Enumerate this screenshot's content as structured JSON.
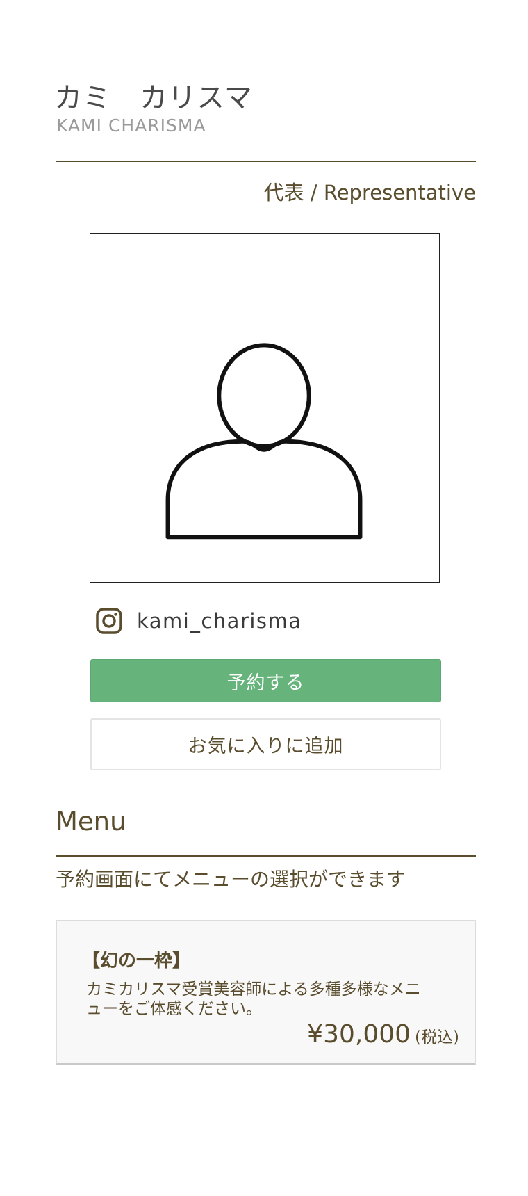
{
  "profile": {
    "name_jp": "カミ　カリスマ",
    "name_en": "KAMI CHARISMA",
    "role": "代表 / Representative",
    "photo_icon": "person-placeholder-icon",
    "instagram_icon": "instagram-icon",
    "instagram_handle": "kami_charisma"
  },
  "actions": {
    "reserve_label": "予約する",
    "favorite_label": "お気に入りに追加"
  },
  "menu": {
    "heading": "Menu",
    "note": "予約画面にてメニューの選択ができます",
    "items": [
      {
        "title": "【幻の一枠】",
        "description": "カミカリスマ受賞美容師による多種多様なメニューをご体感ください。",
        "price": "¥30,000",
        "tax_note": "(税込)"
      }
    ]
  },
  "colors": {
    "text_brown": "#5a4d2e",
    "reserve_green": "#66b47b",
    "card_bg": "#f8f8f8"
  }
}
